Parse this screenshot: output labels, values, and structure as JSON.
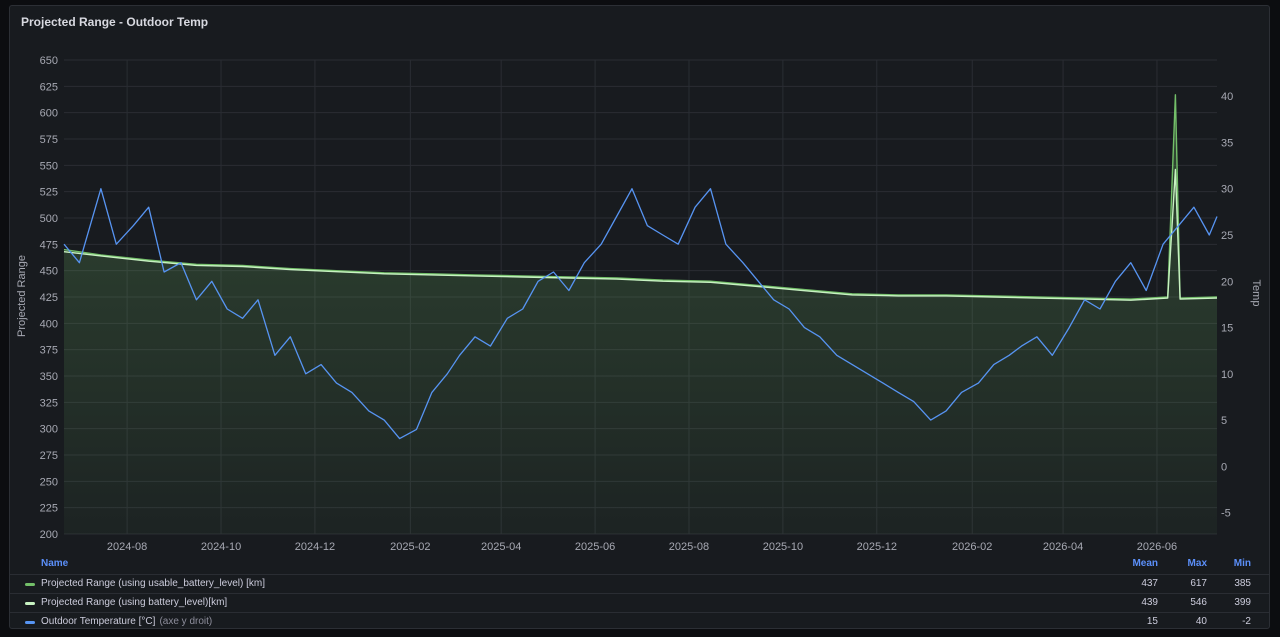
{
  "panel": {
    "title": "Projected Range - Outdoor Temp"
  },
  "colors": {
    "usable": "#73bf69",
    "battery": "#c8f2c2",
    "temp": "#5794f2",
    "fill": "#73bf69"
  },
  "chart_data": {
    "type": "line",
    "y_left": {
      "label": "Projected Range",
      "range": [
        200,
        650
      ],
      "ticks": [
        200,
        225,
        250,
        275,
        300,
        325,
        350,
        375,
        400,
        425,
        450,
        475,
        500,
        525,
        550,
        575,
        600,
        625,
        650
      ]
    },
    "y_right": {
      "label": "Temp",
      "range": [
        -7.3,
        43.9
      ],
      "ticks": [
        -5,
        0,
        5,
        10,
        15,
        20,
        25,
        30,
        35,
        40
      ]
    },
    "x_axis": {
      "range": [
        "2024-06-21",
        "2026-07-10"
      ],
      "ticks": [
        "2024-08",
        "2024-10",
        "2024-12",
        "2025-02",
        "2025-04",
        "2025-06",
        "2025-08",
        "2025-10",
        "2025-12",
        "2026-02",
        "2026-04",
        "2026-06"
      ]
    },
    "grid": true,
    "legend_position": "bottom",
    "series": [
      {
        "name": "Projected Range (using usable_battery_level) [km]",
        "axis": "left",
        "points": [
          [
            "2024-06-21",
            470
          ],
          [
            "2024-07-15",
            465
          ],
          [
            "2024-08-15",
            460
          ],
          [
            "2024-09-15",
            456
          ],
          [
            "2024-10-15",
            455
          ],
          [
            "2024-11-15",
            452
          ],
          [
            "2024-12-15",
            450
          ],
          [
            "2025-01-15",
            448
          ],
          [
            "2025-02-15",
            447
          ],
          [
            "2025-03-15",
            446
          ],
          [
            "2025-04-15",
            445
          ],
          [
            "2025-05-15",
            444
          ],
          [
            "2025-06-15",
            443
          ],
          [
            "2025-07-15",
            441
          ],
          [
            "2025-08-15",
            440
          ],
          [
            "2025-09-15",
            436
          ],
          [
            "2025-10-15",
            432
          ],
          [
            "2025-11-15",
            428
          ],
          [
            "2025-12-15",
            427
          ],
          [
            "2026-01-15",
            427
          ],
          [
            "2026-02-15",
            426
          ],
          [
            "2026-03-15",
            425
          ],
          [
            "2026-04-15",
            424
          ],
          [
            "2026-05-15",
            423
          ],
          [
            "2026-06-08",
            425
          ],
          [
            "2026-06-13",
            617
          ],
          [
            "2026-06-16",
            424
          ],
          [
            "2026-07-10",
            425
          ]
        ]
      },
      {
        "name": "Projected Range (using battery_level)[km]",
        "axis": "left",
        "points": [
          [
            "2024-06-21",
            468
          ],
          [
            "2024-07-15",
            464
          ],
          [
            "2024-08-15",
            459
          ],
          [
            "2024-09-15",
            455
          ],
          [
            "2024-10-15",
            454
          ],
          [
            "2024-11-15",
            451
          ],
          [
            "2024-12-15",
            449
          ],
          [
            "2025-01-15",
            447
          ],
          [
            "2025-02-15",
            446
          ],
          [
            "2025-03-15",
            445
          ],
          [
            "2025-04-15",
            444
          ],
          [
            "2025-05-15",
            443
          ],
          [
            "2025-06-15",
            442
          ],
          [
            "2025-07-15",
            440
          ],
          [
            "2025-08-15",
            439
          ],
          [
            "2025-09-15",
            435
          ],
          [
            "2025-10-15",
            431
          ],
          [
            "2025-11-15",
            427
          ],
          [
            "2025-12-15",
            426
          ],
          [
            "2026-01-15",
            426
          ],
          [
            "2026-02-15",
            425
          ],
          [
            "2026-03-15",
            424
          ],
          [
            "2026-04-15",
            423
          ],
          [
            "2026-05-15",
            422
          ],
          [
            "2026-06-08",
            424
          ],
          [
            "2026-06-13",
            546
          ],
          [
            "2026-06-16",
            423
          ],
          [
            "2026-07-10",
            424
          ]
        ]
      },
      {
        "name": "Outdoor Temperature [°C]",
        "suffix": "(axe y droit)",
        "axis": "right",
        "points": [
          [
            "2024-06-21",
            24
          ],
          [
            "2024-07-01",
            22
          ],
          [
            "2024-07-15",
            30
          ],
          [
            "2024-07-25",
            24
          ],
          [
            "2024-08-05",
            26
          ],
          [
            "2024-08-15",
            28
          ],
          [
            "2024-08-25",
            21
          ],
          [
            "2024-09-05",
            22
          ],
          [
            "2024-09-15",
            18
          ],
          [
            "2024-09-25",
            20
          ],
          [
            "2024-10-05",
            17
          ],
          [
            "2024-10-15",
            16
          ],
          [
            "2024-10-25",
            18
          ],
          [
            "2024-11-05",
            12
          ],
          [
            "2024-11-15",
            14
          ],
          [
            "2024-11-25",
            10
          ],
          [
            "2024-12-05",
            11
          ],
          [
            "2024-12-15",
            9
          ],
          [
            "2024-12-25",
            8
          ],
          [
            "2025-01-05",
            6
          ],
          [
            "2025-01-15",
            5
          ],
          [
            "2025-01-25",
            3
          ],
          [
            "2025-02-05",
            4
          ],
          [
            "2025-02-15",
            8
          ],
          [
            "2025-02-25",
            10
          ],
          [
            "2025-03-05",
            12
          ],
          [
            "2025-03-15",
            14
          ],
          [
            "2025-03-25",
            13
          ],
          [
            "2025-04-05",
            16
          ],
          [
            "2025-04-15",
            17
          ],
          [
            "2025-04-25",
            20
          ],
          [
            "2025-05-05",
            21
          ],
          [
            "2025-05-15",
            19
          ],
          [
            "2025-05-25",
            22
          ],
          [
            "2025-06-05",
            24
          ],
          [
            "2025-06-15",
            27
          ],
          [
            "2025-06-25",
            30
          ],
          [
            "2025-07-05",
            26
          ],
          [
            "2025-07-15",
            25
          ],
          [
            "2025-07-25",
            24
          ],
          [
            "2025-08-05",
            28
          ],
          [
            "2025-08-15",
            30
          ],
          [
            "2025-08-25",
            24
          ],
          [
            "2025-09-05",
            22
          ],
          [
            "2025-09-15",
            20
          ],
          [
            "2025-09-25",
            18
          ],
          [
            "2025-10-05",
            17
          ],
          [
            "2025-10-15",
            15
          ],
          [
            "2025-10-25",
            14
          ],
          [
            "2025-11-05",
            12
          ],
          [
            "2025-11-15",
            11
          ],
          [
            "2025-11-25",
            10
          ],
          [
            "2025-12-05",
            9
          ],
          [
            "2025-12-15",
            8
          ],
          [
            "2025-12-25",
            7
          ],
          [
            "2026-01-05",
            5
          ],
          [
            "2026-01-15",
            6
          ],
          [
            "2026-01-25",
            8
          ],
          [
            "2026-02-05",
            9
          ],
          [
            "2026-02-15",
            11
          ],
          [
            "2026-02-25",
            12
          ],
          [
            "2026-03-05",
            13
          ],
          [
            "2026-03-15",
            14
          ],
          [
            "2026-03-25",
            12
          ],
          [
            "2026-04-05",
            15
          ],
          [
            "2026-04-15",
            18
          ],
          [
            "2026-04-25",
            17
          ],
          [
            "2026-05-05",
            20
          ],
          [
            "2026-05-15",
            22
          ],
          [
            "2026-05-25",
            19
          ],
          [
            "2026-06-05",
            24
          ],
          [
            "2026-06-15",
            26
          ],
          [
            "2026-06-25",
            28
          ],
          [
            "2026-07-05",
            25
          ],
          [
            "2026-07-10",
            27
          ]
        ]
      }
    ]
  },
  "legend": {
    "headers": {
      "name": "Name",
      "mean": "Mean",
      "max": "Max",
      "min": "Min"
    },
    "rows": [
      {
        "name": "Projected Range (using usable_battery_level) [km]",
        "suffix": "",
        "mean": "437",
        "max": "617",
        "min": "385"
      },
      {
        "name": "Projected Range (using battery_level)[km]",
        "suffix": "",
        "mean": "439",
        "max": "546",
        "min": "399"
      },
      {
        "name": "Outdoor Temperature [°C]",
        "suffix": "(axe y droit)",
        "mean": "15",
        "max": "40",
        "min": "-2"
      }
    ]
  }
}
